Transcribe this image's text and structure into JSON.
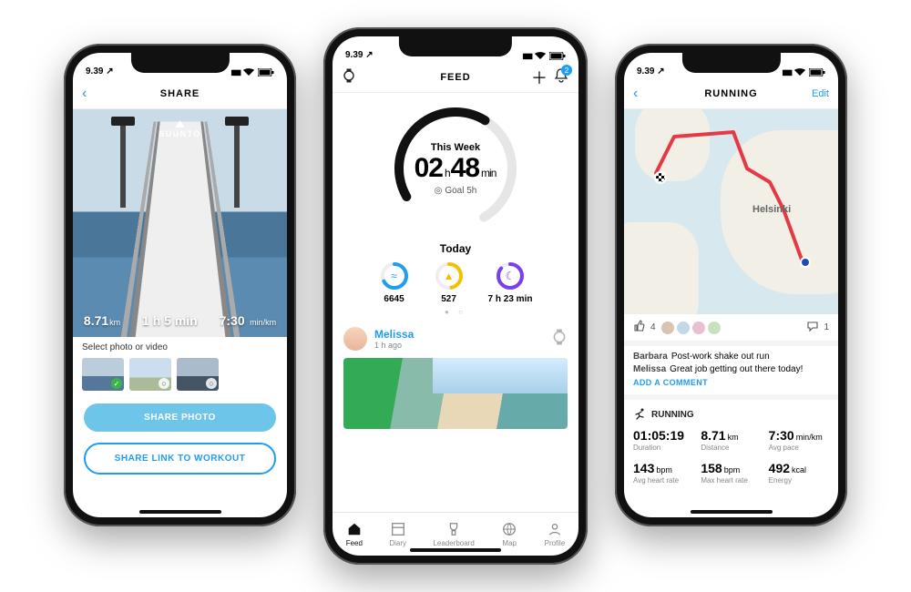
{
  "status": {
    "time": "9.39 ↗"
  },
  "share": {
    "title": "SHARE",
    "brand": "SUUNTO",
    "stats": {
      "distance_val": "8.71",
      "distance_unit": "km",
      "duration": "1 h 5 min",
      "pace_val": "7:30",
      "pace_unit": "min/km"
    },
    "select_label": "Select photo or video",
    "btn_primary": "SHARE PHOTO",
    "btn_secondary": "SHARE LINK TO WORKOUT"
  },
  "feed": {
    "title": "FEED",
    "badge": "2",
    "week_label": "This Week",
    "hours": "02",
    "mins": "48",
    "h_unit": "h",
    "m_unit": "min",
    "goal": "Goal 5h",
    "today": "Today",
    "mini": {
      "steps": "6645",
      "cal": "527",
      "sleep": "7 h 23 min"
    },
    "post": {
      "name": "Melissa",
      "time": "1 h ago"
    },
    "tabs": {
      "feed": "Feed",
      "diary": "Diary",
      "leaderboard": "Leaderboard",
      "map": "Map",
      "profile": "Profile"
    }
  },
  "run": {
    "title": "RUNNING",
    "edit": "Edit",
    "city": "Helsinki",
    "likes": "4",
    "comment_count": "1",
    "comments": [
      {
        "who": "Barbara",
        "text": "Post-work shake out run"
      },
      {
        "who": "Melissa",
        "text": "Great job getting out there today!"
      }
    ],
    "add_comment": "ADD A COMMENT",
    "section": "RUNNING",
    "stats": {
      "duration": {
        "v": "01:05:19",
        "l": "Duration"
      },
      "distance": {
        "v": "8.71",
        "u": "km",
        "l": "Distance"
      },
      "pace": {
        "v": "7:30",
        "u": "min/km",
        "l": "Avg pace"
      },
      "avghr": {
        "v": "143",
        "u": "bpm",
        "l": "Avg heart rate"
      },
      "maxhr": {
        "v": "158",
        "u": "bpm",
        "l": "Max heart rate"
      },
      "energy": {
        "v": "492",
        "u": "kcal",
        "l": "Energy"
      }
    }
  }
}
